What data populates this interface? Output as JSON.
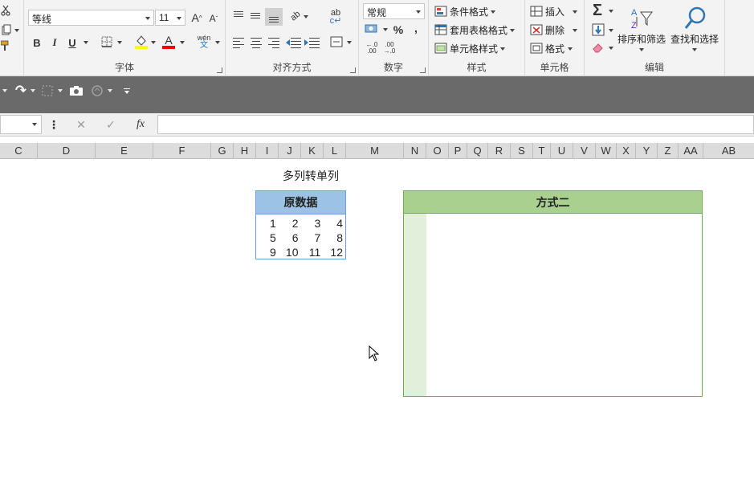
{
  "ribbon": {
    "font_group": {
      "label": "字体",
      "font_name": "等线",
      "font_size": "11",
      "bold": "B",
      "italic": "I",
      "underline": "U",
      "phonetic_top": "wén",
      "phonetic_bottom": "文",
      "font_color_glyph": "A",
      "highlight_color": "#ffff00",
      "font_color": "#ff0000"
    },
    "alignment_group": {
      "label": "对齐方式",
      "wrap_glyph": "ab c"
    },
    "number_group": {
      "label": "数字",
      "format": "常规",
      "percent": "%",
      "comma": ",",
      "dec_inc_top": "←.0",
      "dec_inc_bottom": ".00",
      "dec_dec_top": ".00",
      "dec_dec_bottom": "→.0"
    },
    "styles_group": {
      "label": "样式",
      "conditional": "条件格式",
      "table_format": "套用表格格式",
      "cell_styles": "单元格样式"
    },
    "cells_group": {
      "label": "单元格",
      "insert": "插入",
      "delete": "删除",
      "format": "格式"
    },
    "editing_group": {
      "label": "编辑",
      "sum_glyph": "Σ",
      "sort_filter": "排序和筛选",
      "find_select": "查找和选择"
    }
  },
  "formula_bar": {
    "fx": "fx",
    "cancel": "✕",
    "confirm": "✓",
    "menu": "⋮"
  },
  "columns": [
    "C",
    "D",
    "E",
    "F",
    "G",
    "H",
    "I",
    "J",
    "K",
    "L",
    "M",
    "N",
    "O",
    "P",
    "Q",
    "R",
    "S",
    "T",
    "U",
    "V",
    "W",
    "X",
    "Y",
    "Z",
    "AA",
    "AB"
  ],
  "sheet": {
    "title": "多列转单列",
    "source_table": {
      "header": "原数据",
      "rows": [
        [
          "1",
          "2",
          "3",
          "4"
        ],
        [
          "5",
          "6",
          "7",
          "8"
        ],
        [
          "9",
          "10",
          "11",
          "12"
        ]
      ]
    },
    "result": {
      "header": "方式二"
    }
  },
  "colors": {
    "source_header": "#9cc2e5",
    "source_border": "#6f9fd8",
    "result_header": "#a9d08e",
    "result_border": "#70ad47",
    "result_side": "#e2efda",
    "toolbar": "#6a6a6a"
  }
}
